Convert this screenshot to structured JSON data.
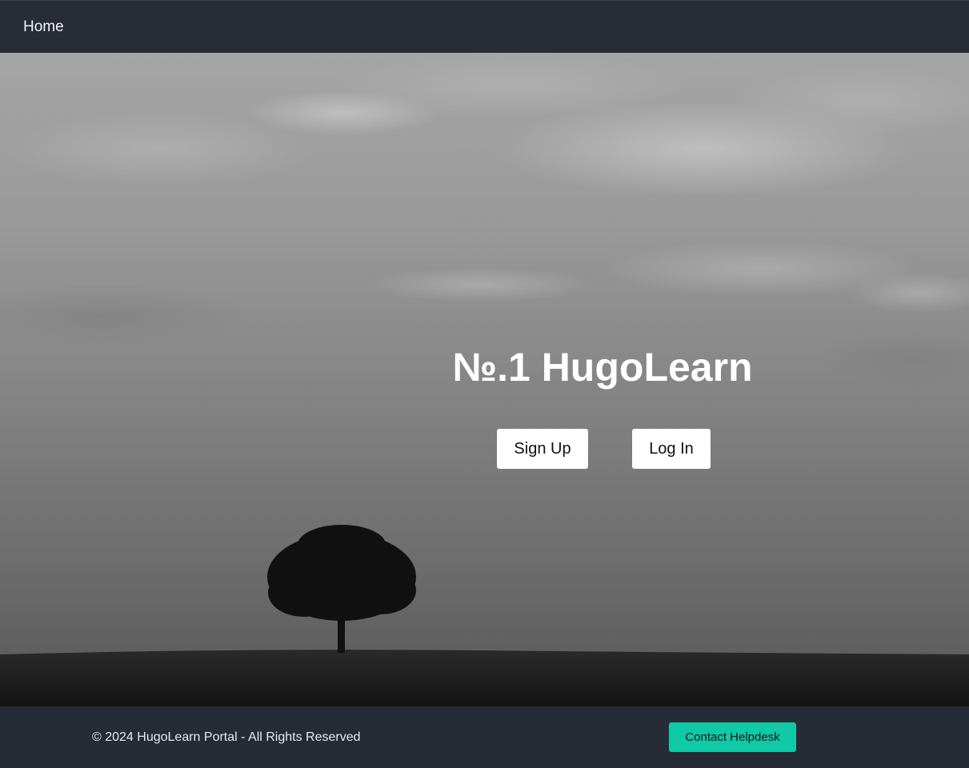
{
  "navbar": {
    "home_label": "Home"
  },
  "hero": {
    "title": "№.1 HugoLearn",
    "signup_label": "Sign Up",
    "login_label": "Log In",
    "background_image": "grayscale-cloudy-sky-lone-tree-field"
  },
  "footer": {
    "copyright": "© 2024 HugoLearn Portal - All Rights Reserved",
    "helpdesk_label": "Contact Helpdesk"
  },
  "colors": {
    "navbar_bg": "#282c37",
    "footer_bg": "#272b36",
    "helpdesk_accent": "#10c9a6",
    "button_bg": "#ffffff"
  }
}
